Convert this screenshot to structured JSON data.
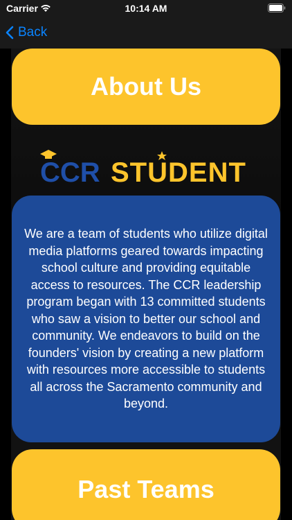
{
  "status_bar": {
    "carrier": "Carrier",
    "time": "10:14 AM",
    "wifi_icon": "wifi-icon",
    "battery_icon": "battery-icon"
  },
  "nav": {
    "back_label": "Back",
    "back_icon": "chevron-left-icon",
    "accent": "#0a84ff"
  },
  "main": {
    "about_button_label": "About Us",
    "logo": {
      "text_left": "CCR",
      "text_right": "STUDENT"
    },
    "description": "We are a team of students who utilize digital media platforms geared towards impacting school culture and providing equitable access to resources. The CCR leadership program began with 13 committed students who saw a vision to better our school and community. We endeavors to build on the founders' vision by creating a new platform with resources more accessible to students all across the Sacramento community and beyond.",
    "past_teams_button_label": "Past Teams"
  },
  "colors": {
    "yellow": "#fdc42c",
    "blue": "#1d4a98",
    "background": "#000000"
  }
}
